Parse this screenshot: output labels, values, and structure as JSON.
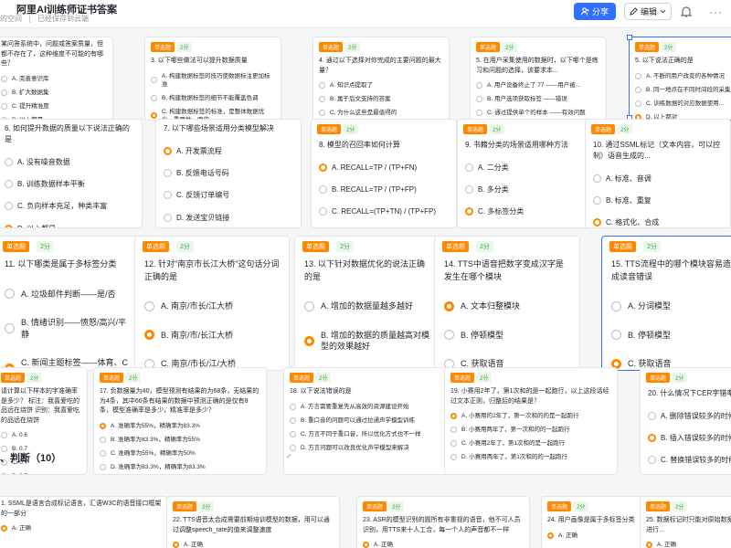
{
  "header": {
    "title": "阿里AI训练师证书答案",
    "breadcrumb_space": "的空间",
    "breadcrumb_status": "已经保存到云端",
    "share_label": "分享",
    "edit_label": "编辑"
  },
  "tags": {
    "single": "单选题",
    "score": "2分"
  },
  "row1": [
    {
      "q": "某问答系统中，问题或答案质量，但都不存在了，这种维度不可能的有哪些？",
      "opts": [
        "A. 完善意识库",
        "B. 扩大数据集",
        "C. 提升精准度",
        "D. 以上都是"
      ],
      "sel": -1
    },
    {
      "q": "3. 以下哪些做法可以提升数据质量",
      "opts": [
        "A. 构建数据标签的技巧使数据标注更加标准",
        "B. 构建数据标签的细节不能覆盖色调",
        "C. 构建数据标签的标准，是整体数据优化、重要性一定的",
        "D. 构建数据标签的规范要求一定标准"
      ],
      "sel": 2
    },
    {
      "q": "4. 通过以下选择对你完成的主要问题的最大量？",
      "opts": [
        "A. 知识点提取了",
        "B. 属于后文支持的答案",
        "C. 为什么这些是最值得的",
        "D. 结构化的主要观"
      ],
      "sel": 3
    },
    {
      "q": "5. 在用户采集使用的数据时，以下哪个是练习和问题的选择，该要求本...",
      "opts": [
        "A. 用户设备终止了 77 ——用户被...",
        "B. 用户选项获取标签 ——错误",
        "C. 通过提供单个的样本 ——有效问题",
        "D. 通过无用数据 ——不是其他"
      ],
      "sel": 3
    },
    {
      "q": "5. 以下说法正确的是",
      "opts": [
        "A. 不断的用户改变的各种情况",
        "B. 同一地点在不同时间段的采集...",
        "C. 训练数据的对应数据使用...",
        "D. 以上都对"
      ],
      "sel": 3
    }
  ],
  "row2": [
    {
      "q": "6. 如何提升数据的质量以下说法正确的是",
      "opts": [
        "A. 没有噪音数据",
        "B. 训练数据样本平衡",
        "C. 负向样本充足，种类丰富",
        "D. 以上都是"
      ],
      "sel": 3
    },
    {
      "q": "7. 以下哪些场景适用分类模型解决",
      "opts": [
        "A. 开发票流程",
        "B. 反馈电话号码",
        "C. 反馈订单编号",
        "D. 发送宝贝链接"
      ],
      "sel": 0
    },
    {
      "q": "8. 模型的召回率如何计算",
      "opts": [
        "A. RECALL=TP / (TP+FN)",
        "B. RECALL=TP / (TP+FP)",
        "C. RECALL=(TP+TN) / (TP+FP)",
        "D. RECALL=(TP+TN) / (TP+FP+TN)"
      ],
      "sel": 0
    },
    {
      "q": "9. 书籍分类的场景适用哪种方法",
      "opts": [
        "A. 二分类",
        "B. 多分类",
        "C. 多标签分类",
        "D. 多模态"
      ],
      "sel": 2
    },
    {
      "q": "10. 通过SSML标记（文本内容，可以控制）语音生成的...",
      "opts": [
        "A. 标准、音调",
        "B. 标准、重复",
        "C. 格式化、合成",
        "D. 通用性、合成"
      ],
      "sel": 2
    }
  ],
  "row3": [
    {
      "q": "11. 以下哪类是属于多标签分类",
      "opts": [
        "A. 垃圾邮件判断——是/否",
        "B. 情绪识别——愤怒/高兴/平静",
        "C. 新闻主题标签——体育、C罗、欧冠",
        "D. 以上都是"
      ],
      "sel": 2
    },
    {
      "q": "12. 针对\"南京市长江大桥\"这句话分词正确的是",
      "opts": [
        "A. 南京/市长/江大桥",
        "B. 南京/市/长江大桥",
        "C. 南京/市长/江/大桥",
        "D. 南京/市/长江/大/桥"
      ],
      "sel": 1
    },
    {
      "q": "13. 以下针对数据优化的说法正确的是",
      "opts": [
        "A. 增加的数据量越多越好",
        "B. 增加的数据的质量越高对模型的效果越好",
        "C. 增加的数据类型越丰富越好",
        "D. 模型的正负样本量不影响模型效果"
      ],
      "sel": 1
    },
    {
      "q": "14. TTS中语音把数字变成汉字是发生在哪个模块",
      "opts": [
        "A. 文本归整模块",
        "B. 停顿模型",
        "C. 获取语音",
        "D. 分句模块"
      ],
      "sel": 0
    },
    {
      "q": "15. TTS流程中的哪个模块容易造成读音错误",
      "opts": [
        "A. 分词模型",
        "B. 停顿模型",
        "C. 获取语音",
        "D. 分句模块"
      ],
      "sel": 2
    }
  ],
  "row4": [
    {
      "q": "请计算以下样本的字准确率是多少？ 标注：我喜爱吃的品远在烧饼 识别：我喜爱吃的品远在烧饼",
      "opts": [
        "A. 0.6",
        "B. 0.7",
        "C. 0.7",
        "D. 0.5"
      ],
      "sel": -1
    },
    {
      "q": "17. 负数据量为40，模型预测有结果的为68条，无结果的为4条，其中66条有结果的数据中预测正确的是仅有8条，模型准确率是多少，精准率是多少？",
      "opts": [
        "A. 准确率为55%，精确率为83.3%",
        "B. 准确率为83.3%，精确率为55%",
        "C. 准确率为55%，精确率为50%",
        "D. 准确率为83.3%，精确率为83.3%"
      ],
      "sel": 0
    },
    {
      "q": "18. 以下说法错误的是",
      "opts": [
        "A. 方言需要重复先从高效的资源建设开始",
        "B. 重口音的问题可以通过拉通声学模型训练",
        "C. 方言不同于重口音，所以优化方式也不一样",
        "D. 方言问题可以改良优化声学模型来解决"
      ],
      "sel": -1
    },
    {
      "q": "19. 小赛用2年了，第1次和的是一起跑行，以上这段话经过文本正则，归整后的结果是？",
      "opts": [
        "A. 小赛用的2年了，第一次和的的是一起跑行",
        "B. 小赛用两年了，第一次和的的一起跑行",
        "C. 小赛用2年了，第1次和的是一起跑行",
        "D. 小赛用两年了，第1次和的的一起跑行"
      ],
      "sel": 0
    },
    {
      "q": "20. 什么情况下CER字错率会增加",
      "opts": [
        "A. 删除错误较多的时候",
        "B. 插入错误较多的时候",
        "C. 替换错误较多的时候",
        "D. 以上都对"
      ],
      "sel": 1
    }
  ],
  "section_title": "、判断（10）",
  "row5": [
    {
      "q": "1. SSML是语言合成标记语言，汇语W3C的语音接口框架的一部分",
      "opt": "A. 正确"
    },
    {
      "q": "22. TTS语音太合成需要前期培训模型的数据，用可以通过调整speech_rate的值来调整速度",
      "opt": "A. 正确"
    },
    {
      "q": "23. ASR的模型识别的题所有非重视的语音，他不可人员识别，用TTS来十人工合，每一个人的声音都不一样",
      "opt": "A. 正确"
    },
    {
      "q": "24. 用户画像是属于多标签分类",
      "opt": "A. 正确"
    },
    {
      "q": "25. 数据标记时只能对原始数据进行…",
      "opt": "A. 正确"
    }
  ],
  "colors": {
    "accent": "#3370ff",
    "selected_option": "#ff8800",
    "tag_bg": "#ff8800"
  },
  "icons": [
    "star-icon",
    "share-icon",
    "edit-icon",
    "chevron-down-icon",
    "bell-icon",
    "more-icon",
    "check-icon"
  ]
}
